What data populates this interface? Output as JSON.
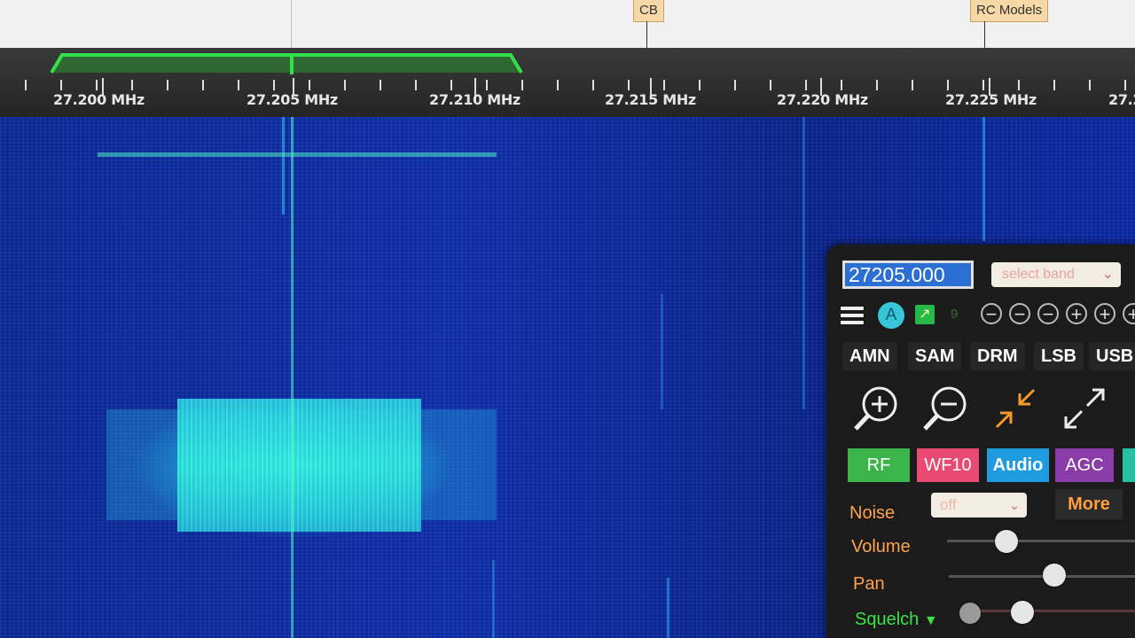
{
  "band_bar": {
    "tags": [
      {
        "label": "CB"
      },
      {
        "label": "RC Models"
      }
    ]
  },
  "scale": {
    "labels": [
      "27.200 MHz",
      "27.205 MHz",
      "27.210 MHz",
      "27.215 MHz",
      "27.220 MHz",
      "27.225 MHz",
      "27.2"
    ],
    "passband_color": "#29d93a"
  },
  "panel": {
    "frequency_value": "27205.000",
    "band_select": "select band",
    "auto_label": "A",
    "icon_number": "9",
    "zoom_buttons": [
      "−",
      "−",
      "−",
      "+",
      "+",
      "+"
    ],
    "modes": [
      "AMN",
      "SAM",
      "DRM",
      "LSB",
      "USB"
    ],
    "tabs": [
      {
        "label": "RF",
        "color": "#3bb54a"
      },
      {
        "label": "WF10",
        "color": "#e84a72"
      },
      {
        "label": "Audio",
        "color": "#1f9be0"
      },
      {
        "label": "AGC",
        "color": "#8a3da8"
      },
      {
        "label": "",
        "color": "#27c0a0"
      }
    ],
    "noise_label": "Noise",
    "noise_value": "off",
    "more_label": "More",
    "volume_label": "Volume",
    "pan_label": "Pan",
    "squelch_label": "Squelch"
  }
}
